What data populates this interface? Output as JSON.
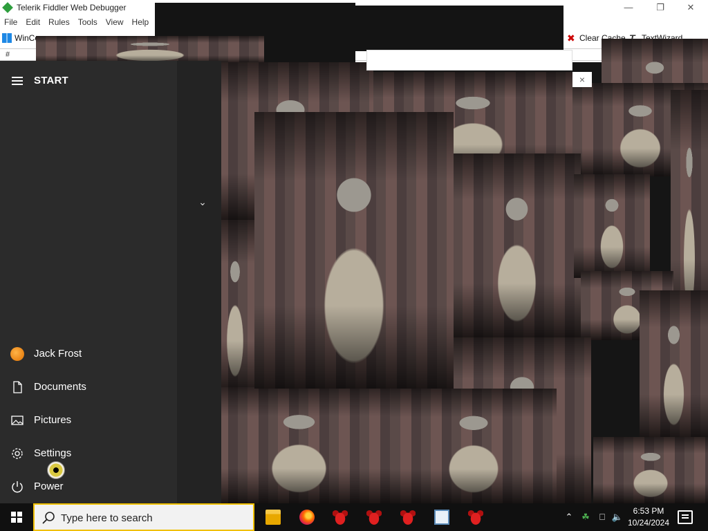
{
  "fiddler": {
    "title": "Telerik Fiddler Web Debugger",
    "menu": [
      "File",
      "Edit",
      "Rules",
      "Tools",
      "View",
      "Help"
    ],
    "toolbar": {
      "winconfig": "WinCo",
      "clear_cache": "Clear Cache",
      "textwizard": "TextWizard"
    },
    "column_header": "#",
    "popup_close": "×"
  },
  "start_menu": {
    "title": "START",
    "items": [
      {
        "label": "Jack Frost",
        "icon": "user-avatar-icon"
      },
      {
        "label": "Documents",
        "icon": "document-icon"
      },
      {
        "label": "Pictures",
        "icon": "pictures-icon"
      },
      {
        "label": "Settings",
        "icon": "gear-icon"
      },
      {
        "label": "Power",
        "icon": "power-icon"
      }
    ]
  },
  "taskbar": {
    "search_placeholder": "Type here to search",
    "apps": [
      "file-explorer-icon",
      "firefox-icon",
      "bull-app-icon",
      "bull-app-icon",
      "bull-app-icon",
      "window-app-icon",
      "bull-app-icon"
    ],
    "time": "6:53 PM",
    "date": "10/24/2024"
  },
  "colors": {
    "start_bg": "#2b2b2b",
    "taskbar_bg": "#101010",
    "search_border": "#f0c000"
  }
}
